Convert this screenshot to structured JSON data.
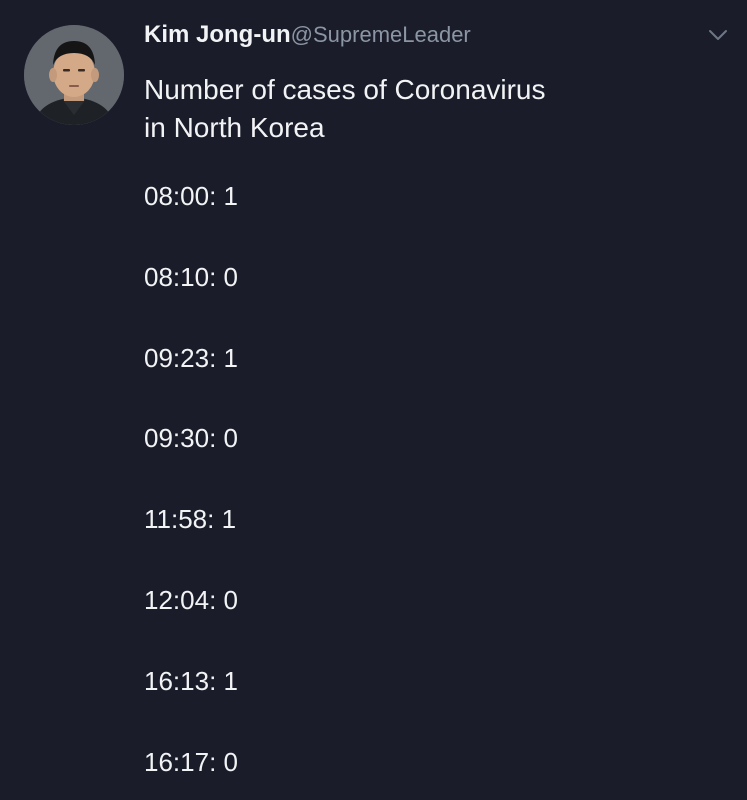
{
  "author": {
    "display_name": "Kim Jong-un",
    "handle": "@SupremeLeader"
  },
  "tweet": {
    "text_lines": [
      "Number of cases of Coronavirus",
      "in North Korea"
    ],
    "entries": [
      "08:00: 1",
      "08:10: 0",
      "09:23: 1",
      "09:30: 0",
      "11:58: 1",
      "12:04: 0",
      "16:13: 1",
      "16:17: 0"
    ]
  },
  "icons": {
    "menu": "chevron-down-icon"
  },
  "colors": {
    "background": "#1a1c2a",
    "text": "#f2f3f5",
    "secondary_text": "#8b95a3"
  }
}
